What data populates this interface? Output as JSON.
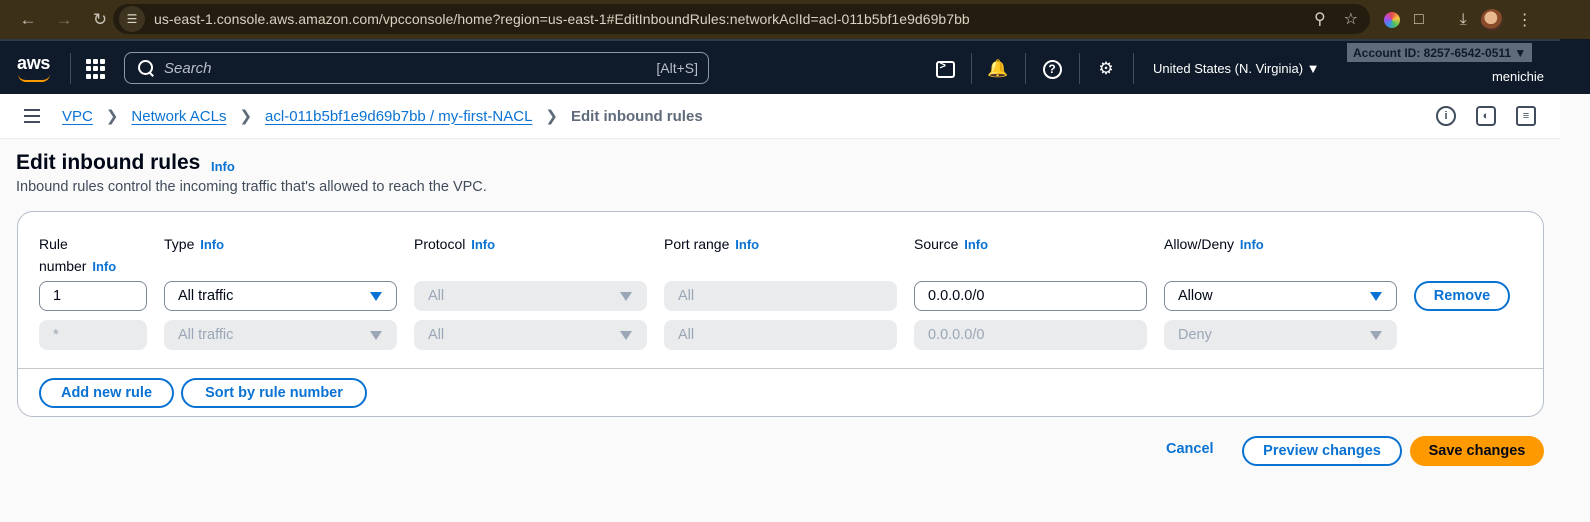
{
  "browser": {
    "url": "us-east-1.console.aws.amazon.com/vpcconsole/home?region=us-east-1#EditInboundRules:networkAclId=acl-011b5bf1e9d69b7bb"
  },
  "topnav": {
    "logo": "aws",
    "search_placeholder": "Search",
    "search_shortcut": "[Alt+S]",
    "region": "United States (N. Virginia) ▼",
    "account": "Account ID: 8257-6542-0511 ▼",
    "user": "menichie"
  },
  "breadcrumb": {
    "items": [
      "VPC",
      "Network ACLs",
      "acl-011b5bf1e9d69b7bb / my-first-NACL"
    ],
    "current": "Edit inbound rules"
  },
  "page": {
    "title": "Edit inbound rules",
    "info": "Info",
    "description": "Inbound rules control the incoming traffic that's allowed to reach the VPC."
  },
  "columns": {
    "rule_number_l1": "Rule",
    "rule_number_l2": "number",
    "type": "Type",
    "protocol": "Protocol",
    "port_range": "Port range",
    "source": "Source",
    "allow_deny": "Allow/Deny",
    "info": "Info"
  },
  "rules": [
    {
      "rule_number": "1",
      "type": "All traffic",
      "protocol": "All",
      "port_range": "All",
      "source": "0.0.0.0/0",
      "allow_deny": "Allow",
      "remove": "Remove"
    },
    {
      "rule_number": "*",
      "type": "All traffic",
      "protocol": "All",
      "port_range": "All",
      "source": "0.0.0.0/0",
      "allow_deny": "Deny"
    }
  ],
  "actions": {
    "add_rule": "Add new rule",
    "sort": "Sort by rule number",
    "cancel": "Cancel",
    "preview": "Preview changes",
    "save": "Save changes"
  },
  "colors": {
    "link": "#0972d3",
    "primary": "#ff9900",
    "nav_bg": "#0f1b2a"
  }
}
